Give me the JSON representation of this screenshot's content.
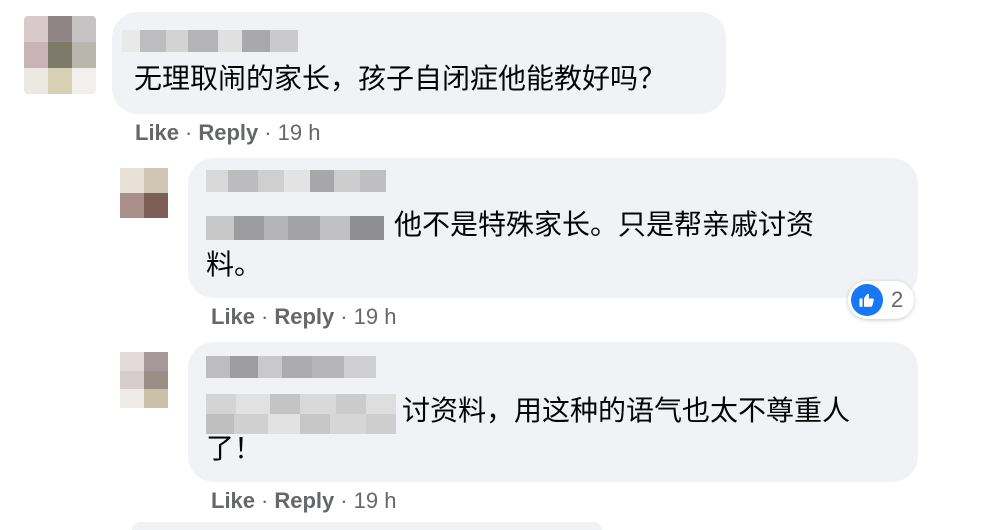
{
  "comments": [
    {
      "text_lines": [
        "无理取闹的家长，孩子自闭症他能教好吗？"
      ],
      "actions": {
        "like": "Like",
        "reply": "Reply",
        "time": "19 h"
      }
    },
    {
      "text_lines": [
        "他不是特殊家长。只是帮亲戚讨资",
        "料。"
      ],
      "actions": {
        "like": "Like",
        "reply": "Reply",
        "time": "19 h"
      },
      "reactions": {
        "icon": "thumbs-up-icon",
        "count": "2"
      }
    },
    {
      "text_lines": [
        "讨资料，用这种的语气也太不尊重人",
        "了！"
      ],
      "actions": {
        "like": "Like",
        "reply": "Reply",
        "time": "19 h"
      }
    }
  ],
  "separator": "·",
  "colors": {
    "bubble": "#f0f2f5",
    "meta_text": "#65676b",
    "like_blue": "#1877f2",
    "text": "#050505"
  }
}
